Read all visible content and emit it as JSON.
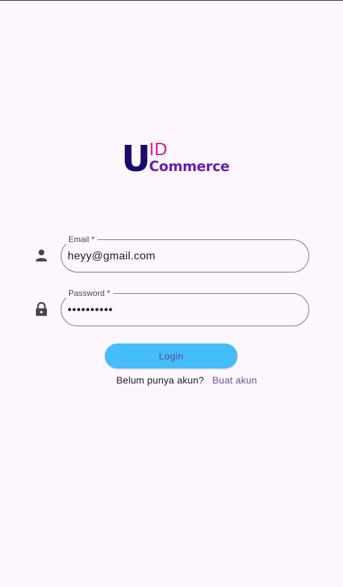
{
  "logo": {
    "letter_u": "U",
    "letters_id": "ID",
    "word_commerce": "Commerce"
  },
  "form": {
    "email": {
      "label": "Email *",
      "value": "heyy@gmail.com",
      "icon": "person-icon"
    },
    "password": {
      "label": "Password *",
      "value": "••••••••••",
      "icon": "lock-icon"
    },
    "login_button": "Login",
    "signup_prompt": "Belum punya akun?",
    "signup_link": "Buat akun"
  },
  "colors": {
    "background": "#fef7fd",
    "logo_u": "#1a0a6b",
    "logo_id": "#d61ea1",
    "logo_commerce": "#6a1faf",
    "login_button_bg": "#44bdf8",
    "link": "#6750a4"
  }
}
